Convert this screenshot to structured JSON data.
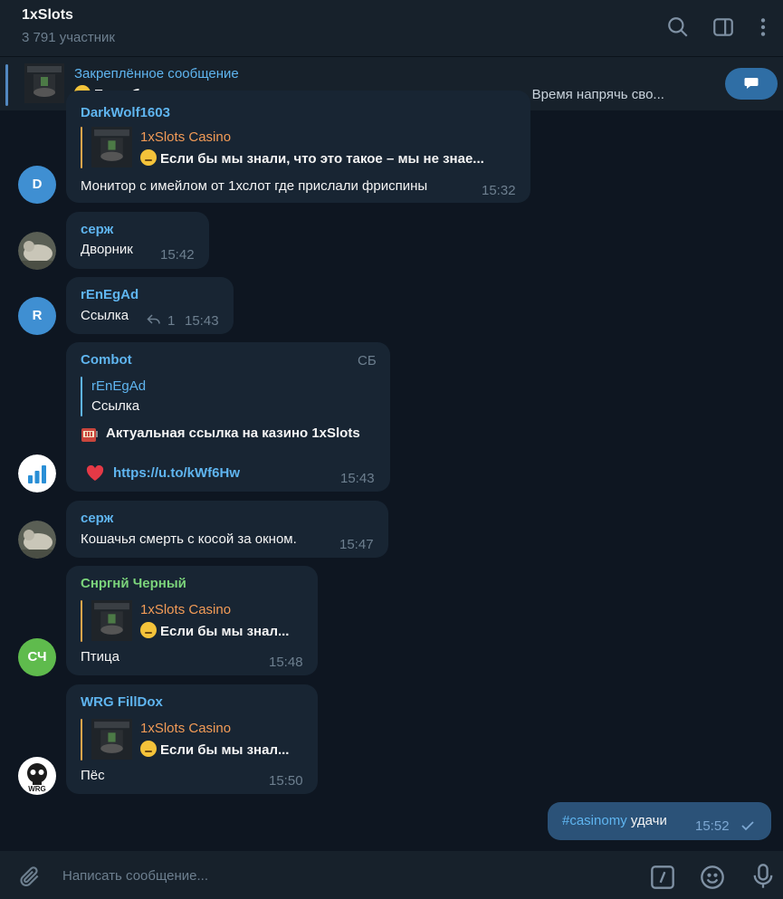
{
  "header": {
    "title": "1xSlots",
    "subtitle": "3 791 участник"
  },
  "pinned": {
    "title": "Закреплённое сообщение",
    "text_bold": "Если бы мы знали, что это такое – мы не знаем, что это такое...",
    "text_rest": "Время напрячь сво..."
  },
  "messages": {
    "m1": {
      "sender": "DarkWolf1603",
      "reply_title": "1xSlots Casino",
      "reply_text": "Если бы мы знали, что это такое – мы не знае...",
      "text": "Монитор с имейлом от 1хслот где прислали фриспины",
      "time": "15:32",
      "avatar": "D"
    },
    "m2": {
      "sender": "серж",
      "text": "Дворник",
      "time": "15:42"
    },
    "m3": {
      "sender": "rEnEgAd",
      "text": "Ссылка",
      "replies": "1",
      "time": "15:43",
      "avatar": "R"
    },
    "m4": {
      "sender": "Combot",
      "tag": "СБ",
      "reply_title": "rEnEgAd",
      "reply_text": "Ссылка",
      "line1": "Актуальная ссылка на казино 1xSlots",
      "link": "https://u.to/kWf6Hw",
      "time": "15:43"
    },
    "m5": {
      "sender": "серж",
      "text": "Кошачья смерть с косой за окном.",
      "time": "15:47"
    },
    "m6": {
      "sender": "Снргнй Черный",
      "reply_title": "1xSlots Casino",
      "reply_text": "Если бы мы знал...",
      "text": "Птица",
      "time": "15:48",
      "avatar": "СЧ"
    },
    "m7": {
      "sender": "WRG FillDox",
      "reply_title": "1xSlots Casino",
      "reply_text": "Если бы мы знал...",
      "text": "Пёс",
      "time": "15:50",
      "avatar_text": "WRG"
    },
    "own": {
      "hashtag": "#casinomy",
      "text": "удачи",
      "time": "15:52"
    }
  },
  "composer": {
    "placeholder": "Написать сообщение..."
  },
  "colors": {
    "background": "#0e1621",
    "bubble": "#182533",
    "own_bubble": "#2b5278",
    "accent": "#5fb5f0",
    "reply_orange": "#f29b57"
  }
}
